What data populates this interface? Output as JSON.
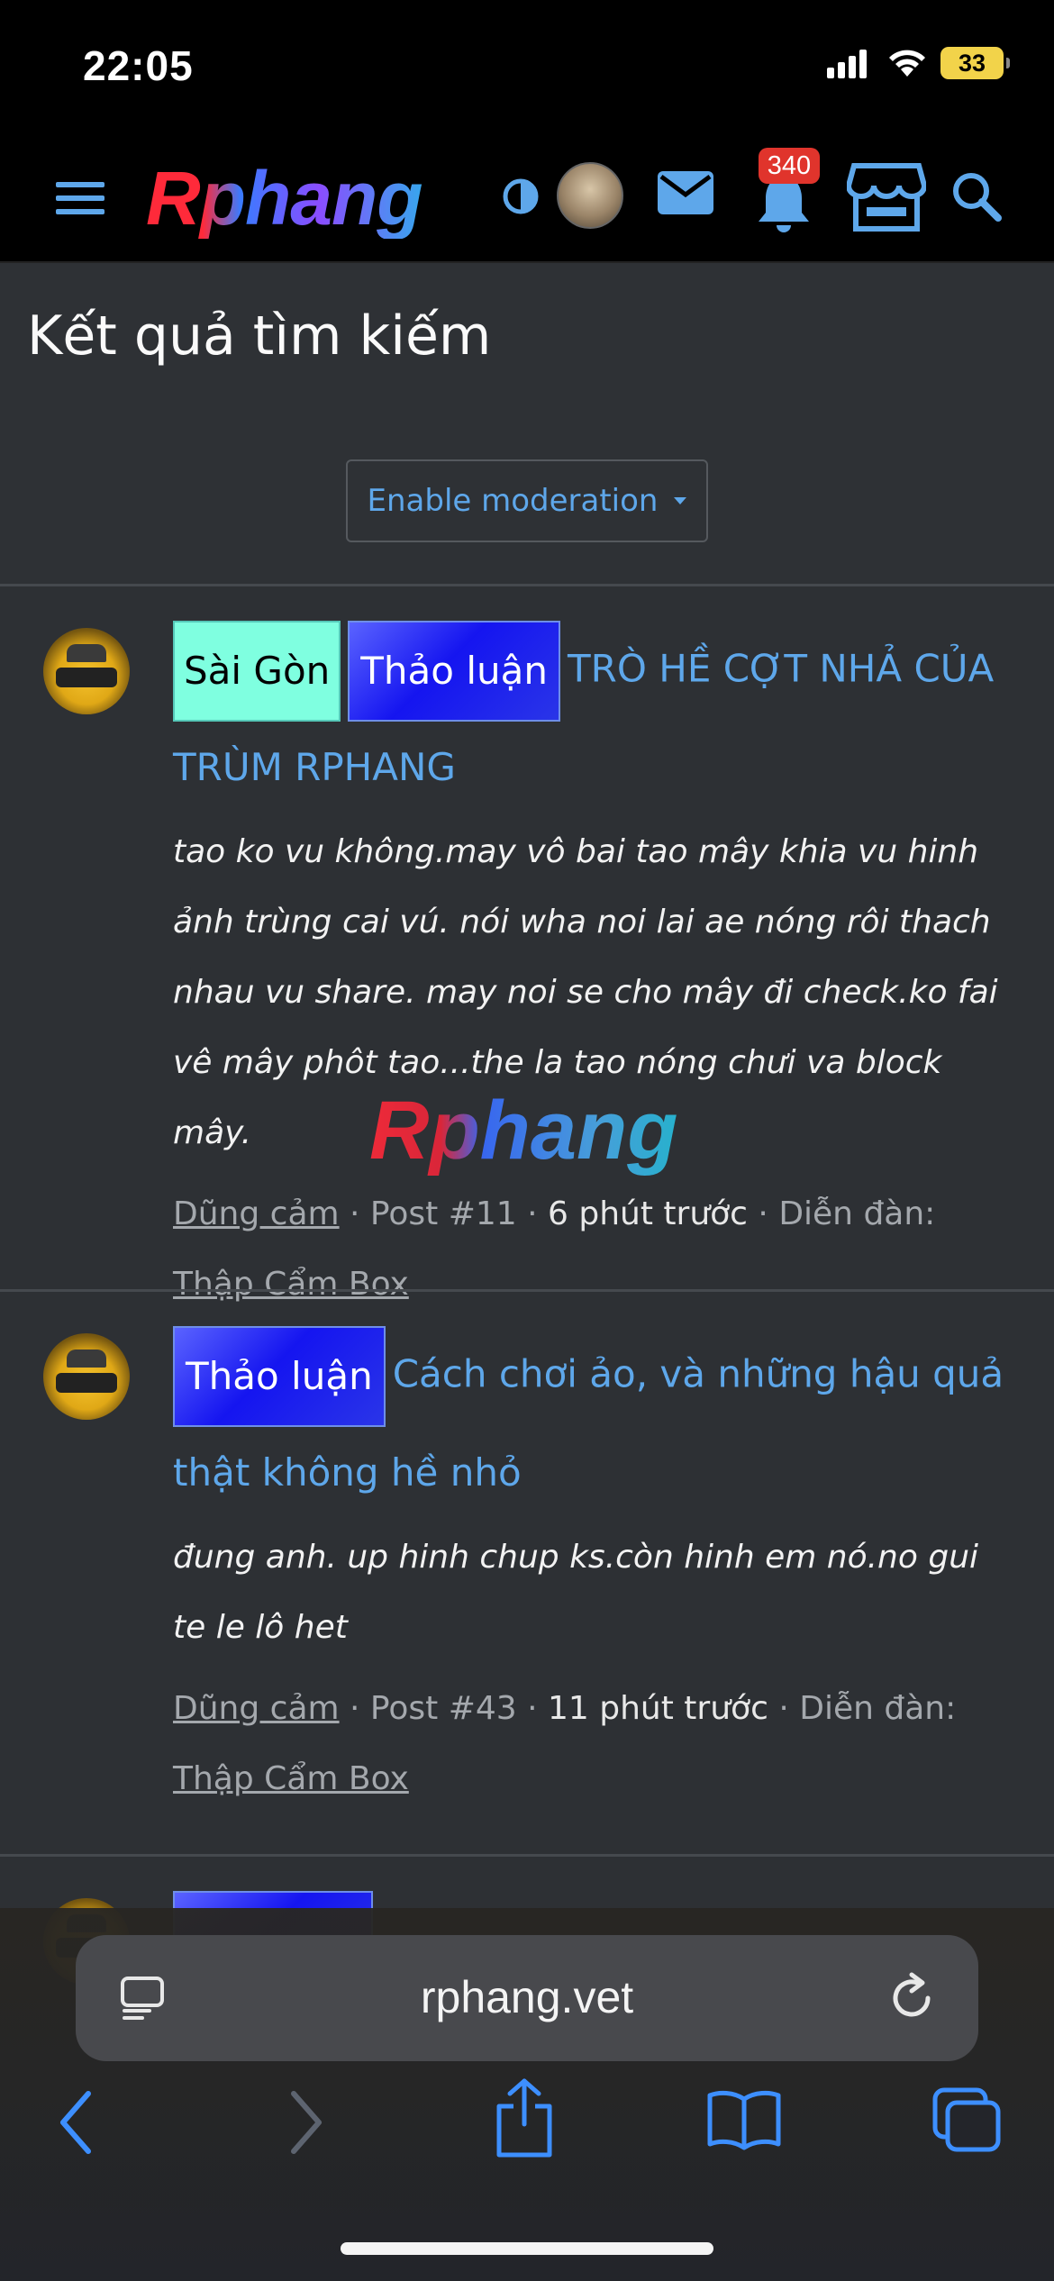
{
  "status_bar": {
    "time": "22:05",
    "battery": "33"
  },
  "header": {
    "logo_text": "Rphang",
    "notification_count": "340",
    "icons": [
      "menu-icon",
      "theme-toggle-icon",
      "avatar",
      "mail-icon",
      "bell-icon",
      "store-icon",
      "search-icon"
    ]
  },
  "page": {
    "title": "Kết quả tìm kiếm",
    "moderation_button": "Enable moderation"
  },
  "results": [
    {
      "tags": [
        {
          "label": "Sài Gòn",
          "color": "#7fffe0"
        },
        {
          "label": "Thảo luận",
          "color": "#1a1af0"
        }
      ],
      "title": "TRÒ HỀ CỢT NHẢ CỦA TRÙM RPHANG",
      "snippet": "tao ko vu không.may vô bai tao mây khia vu hinh ảnh trùng cai vú. nói wha noi lai ae nóng rôi thach nhau vu share. may noi se cho mây đi check.ko fai vê mây phôt tao...the la tao nóng chưi va block mây.",
      "author": "Dũng cảm",
      "post": "Post #11",
      "time": "6 phút trước",
      "forum_label": "Diễn đàn:",
      "forum": "Thập Cẩm Box"
    },
    {
      "tags": [
        {
          "label": "Thảo luận",
          "color": "#1a1af0"
        }
      ],
      "title": "Cách chơi ảo, và những hậu quả thật không hề nhỏ",
      "snippet": "đung anh. up hinh chup ks.còn hinh em nó.no gui te le lô het",
      "author": "Dũng cảm",
      "post": "Post #43",
      "time": "11 phút trước",
      "forum_label": "Diễn đàn:",
      "forum": "Thập Cẩm Box"
    }
  ],
  "watermark": "Rphang",
  "browser": {
    "url": "rphang.vet",
    "icons": [
      "tabs-format-icon",
      "reload-icon",
      "back-icon",
      "forward-icon",
      "share-icon",
      "bookmarks-icon",
      "tabs-icon"
    ]
  },
  "colors": {
    "accent": "#5ea7ea",
    "background": "#2e3135",
    "header": "#000000",
    "badge": "#e0342c"
  }
}
